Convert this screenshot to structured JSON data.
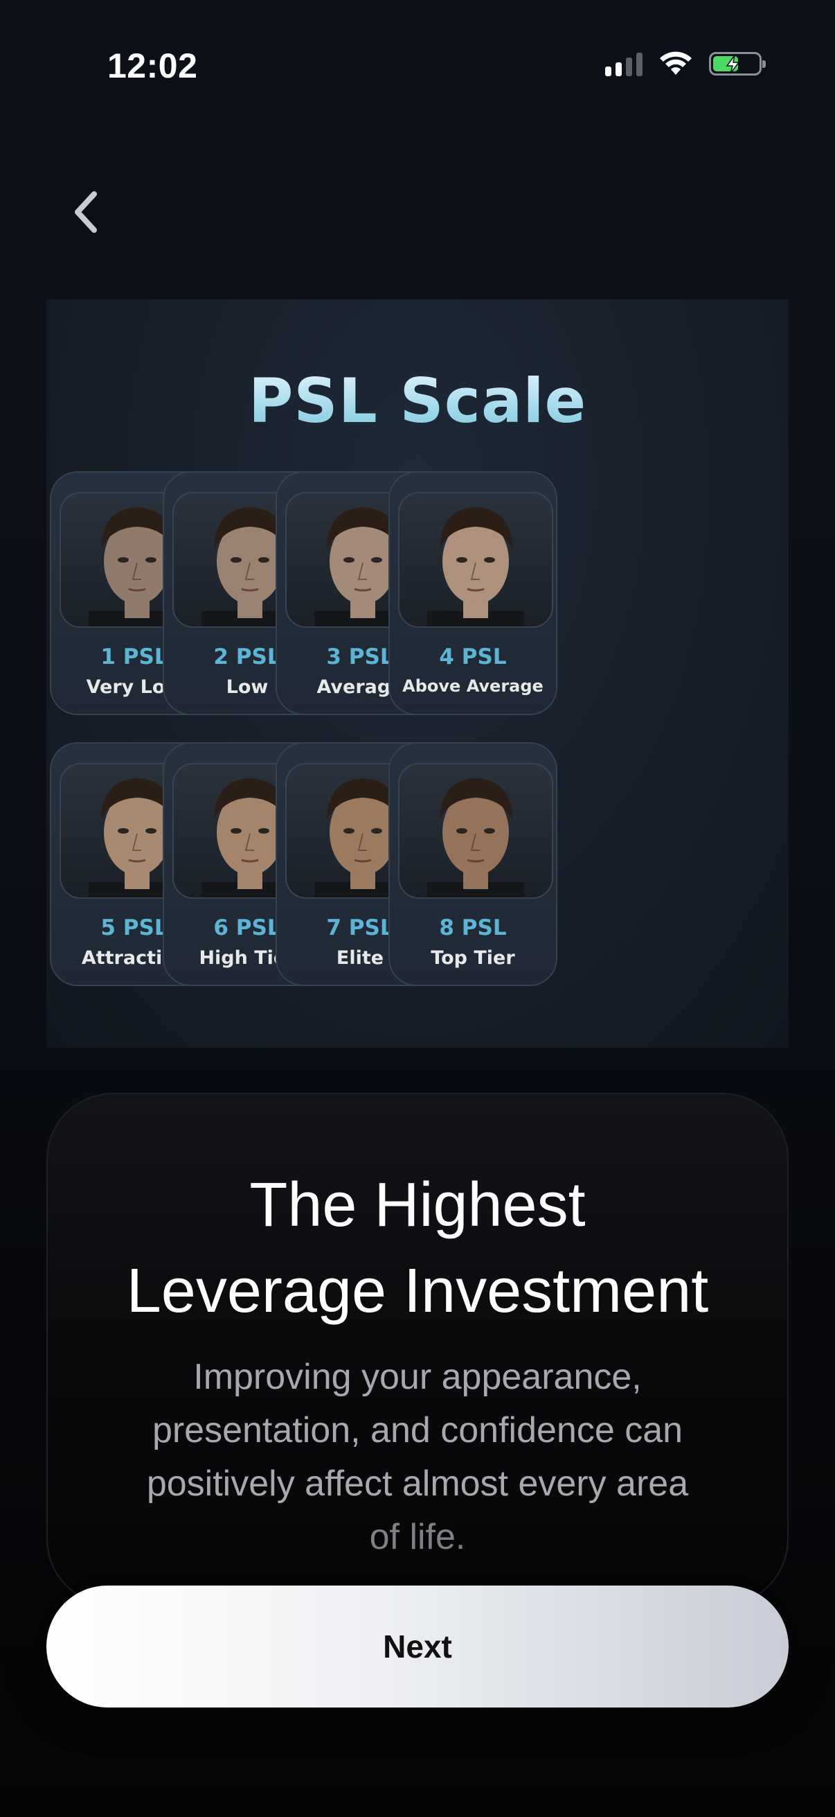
{
  "status_bar": {
    "time": "12:02"
  },
  "psl_scale": {
    "title": "PSL Scale",
    "items": [
      {
        "psl": "1 PSL",
        "tier": "Very Low"
      },
      {
        "psl": "2 PSL",
        "tier": "Low"
      },
      {
        "psl": "3 PSL",
        "tier": "Average"
      },
      {
        "psl": "4 PSL",
        "tier": "Above Average"
      },
      {
        "psl": "5 PSL",
        "tier": "Attractive"
      },
      {
        "psl": "6 PSL",
        "tier": "High Tier"
      },
      {
        "psl": "7 PSL",
        "tier": "Elite"
      },
      {
        "psl": "8 PSL",
        "tier": "Top Tier"
      }
    ]
  },
  "info": {
    "headline_line1": "The Highest",
    "headline_line2": "Leverage Investment",
    "body_line1": "Improving your appearance,",
    "body_line2": "presentation, and confidence can",
    "body_line3": "positively affect almost every area",
    "body_line4": "of life."
  },
  "next_button": {
    "label": "Next"
  },
  "colors": {
    "accent": "#5db5d5",
    "battery": "#4cd964"
  },
  "icons": [
    "back-chevron-icon",
    "cellular-signal-icon",
    "wifi-icon",
    "battery-charging-icon"
  ]
}
